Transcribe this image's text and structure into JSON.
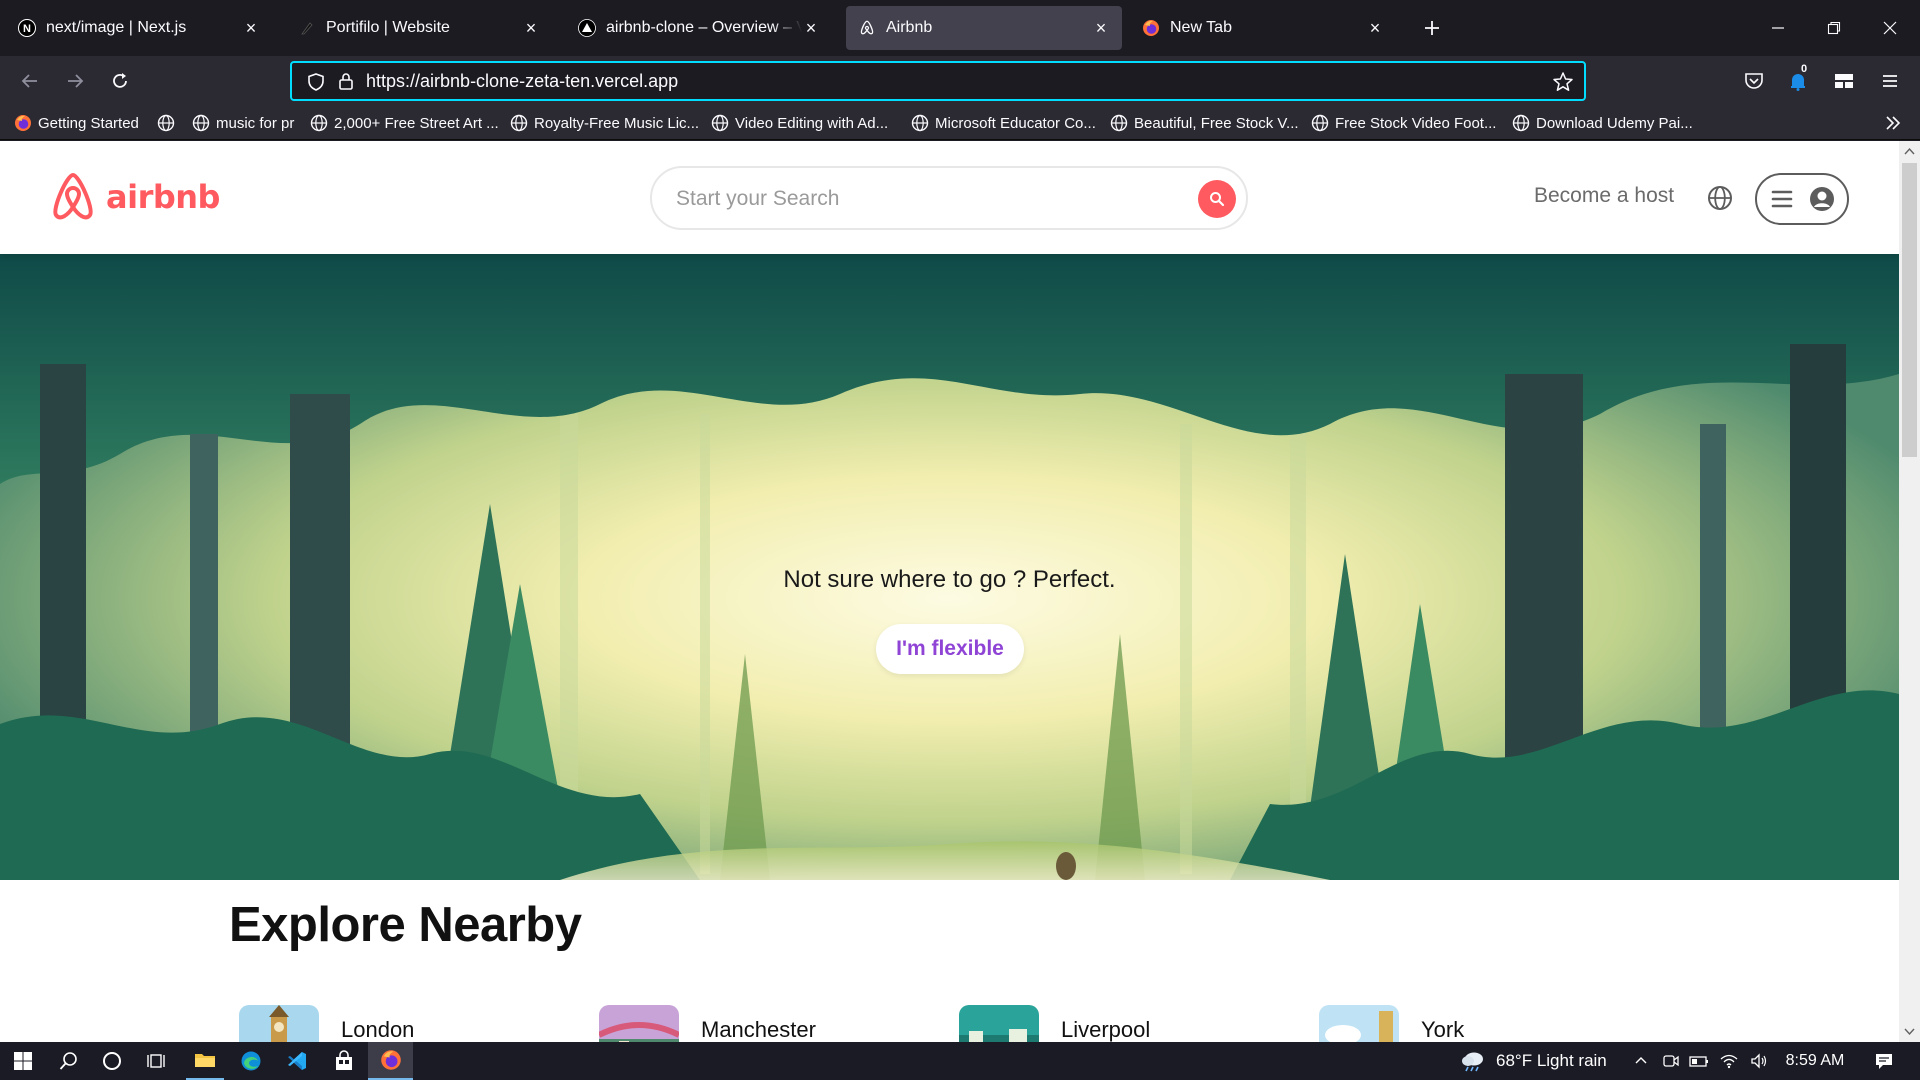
{
  "tabs": [
    {
      "title": "next/image | Next.js",
      "active": false,
      "icon": "nextjs-icon"
    },
    {
      "title": "Portifilo | Website",
      "active": false,
      "icon": "feather-icon"
    },
    {
      "title": "airbnb-clone – Overview – Vercel",
      "active": false,
      "icon": "vercel-icon"
    },
    {
      "title": "Airbnb",
      "active": true,
      "icon": "airbnb-icon"
    },
    {
      "title": "New Tab",
      "active": false,
      "icon": "firefox-icon"
    }
  ],
  "address_bar": {
    "url": "https://airbnb-clone-zeta-ten.vercel.app"
  },
  "toolbar": {
    "notification_count": "0"
  },
  "bookmarks": [
    "Getting Started",
    "music for pr",
    "2,000+ Free Street Art ...",
    "Royalty-Free Music Lic...",
    "Video Editing with Ad...",
    "Microsoft Educator Co...",
    "Beautiful, Free Stock V...",
    "Free Stock Video Foot...",
    "Download Udemy Pai..."
  ],
  "site": {
    "logo_text": "airbnb",
    "search_placeholder": "Start your Search",
    "become_host": "Become a host",
    "hero_text": "Not sure where to go ? Perfect.",
    "hero_button": "I'm flexible",
    "explore_title": "Explore Nearby",
    "cities": [
      "London",
      "Manchester",
      "Liverpool",
      "York"
    ]
  },
  "taskbar": {
    "weather": "68°F  Light rain",
    "time": "8:59 AM"
  },
  "colors": {
    "brand": "#ff5a5f",
    "flexible": "#8f44d6",
    "url_focus": "#00ddff"
  }
}
